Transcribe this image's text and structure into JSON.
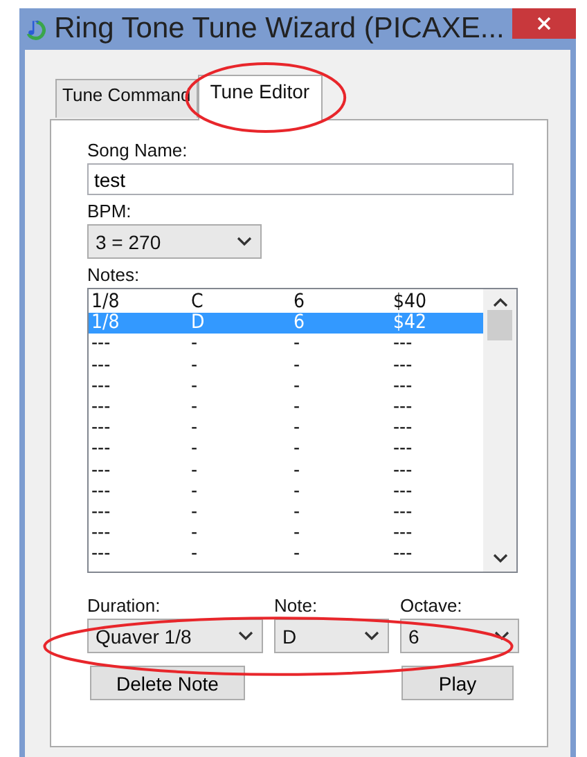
{
  "window": {
    "title": "Ring Tone Tune Wizard (PICAXE..."
  },
  "tabs": [
    {
      "label": "Tune Command",
      "selected": false,
      "circled": false
    },
    {
      "label": "Tune Editor",
      "selected": true,
      "circled": true
    }
  ],
  "song_name": {
    "label": "Song Name:",
    "value": "test"
  },
  "bpm": {
    "label": "BPM:",
    "value": "3 = 270"
  },
  "notes": {
    "label": "Notes:",
    "rows": [
      {
        "cells": [
          "1/8",
          "C",
          "6",
          "$40"
        ],
        "selected": false
      },
      {
        "cells": [
          "1/8",
          "D",
          "6",
          "$42"
        ],
        "selected": true
      },
      {
        "cells": [
          "---",
          "-",
          "-",
          "---"
        ],
        "selected": false
      },
      {
        "cells": [
          "---",
          "-",
          "-",
          "---"
        ],
        "selected": false
      },
      {
        "cells": [
          "---",
          "-",
          "-",
          "---"
        ],
        "selected": false
      },
      {
        "cells": [
          "---",
          "-",
          "-",
          "---"
        ],
        "selected": false
      },
      {
        "cells": [
          "---",
          "-",
          "-",
          "---"
        ],
        "selected": false
      },
      {
        "cells": [
          "---",
          "-",
          "-",
          "---"
        ],
        "selected": false
      },
      {
        "cells": [
          "---",
          "-",
          "-",
          "---"
        ],
        "selected": false
      },
      {
        "cells": [
          "---",
          "-",
          "-",
          "---"
        ],
        "selected": false
      },
      {
        "cells": [
          "---",
          "-",
          "-",
          "---"
        ],
        "selected": false
      },
      {
        "cells": [
          "---",
          "-",
          "-",
          "---"
        ],
        "selected": false
      },
      {
        "cells": [
          "---",
          "-",
          "-",
          "---"
        ],
        "selected": false
      }
    ]
  },
  "selectors": {
    "circled": true,
    "items": [
      {
        "label": "Duration:",
        "value": "Quaver 1/8"
      },
      {
        "label": "Note:",
        "value": "D"
      },
      {
        "label": "Octave:",
        "value": "6"
      }
    ]
  },
  "buttons": [
    "Delete Note",
    "Play"
  ]
}
